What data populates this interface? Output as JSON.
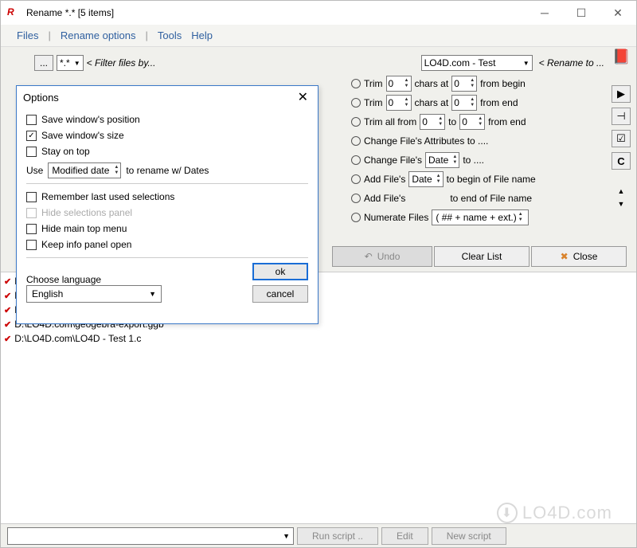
{
  "window": {
    "title": "Rename  *.*    [5 items]"
  },
  "menu": {
    "files": "Files",
    "rename_options": "Rename options",
    "tools": "Tools",
    "help": "Help"
  },
  "toolbar": {
    "browse": "...",
    "filter_value": "*.*",
    "filter_hint": "< Filter files by...",
    "rename_to_value": "LO4D.com - Test",
    "rename_to_hint": "< Rename to ..."
  },
  "radio": {
    "trim_begin_a": "Trim",
    "trim_begin_b": "chars at",
    "trim_begin_c": "from begin",
    "trim_end_c": "from  end",
    "trim_all_a": "Trim all from",
    "trim_all_b": "to",
    "trim_all_c": "from end",
    "change_attr": "Change File's Attributes to ....",
    "change_date_a": "Change File's",
    "change_date_b": "to ....",
    "add_begin_a": "Add File's",
    "add_begin_b": "to begin of File name",
    "add_end_b": "to end of File name",
    "numerate": "Numerate Files",
    "numerate_fmt": "( ## + name + ext.)",
    "date_label": "Date",
    "zero": "0"
  },
  "actions": {
    "undo": "Undo",
    "clear": "Clear List",
    "close": "Close"
  },
  "files": [
    "D:\\",
    "D:\\",
    "D:\\",
    "D:\\LO4D.com\\geogebra-export.ggb",
    "D:\\LO4D.com\\LO4D - Test 1.c"
  ],
  "bottom": {
    "run": "Run script ..",
    "edit": "Edit",
    "new": "New script"
  },
  "dialog": {
    "title": "Options",
    "save_pos": "Save window's position",
    "save_size": "Save window's size",
    "stay_top": "Stay on top",
    "use": "Use",
    "mod_date": "Modified date",
    "rename_dates": "to rename w/ Dates",
    "remember": "Remember last used selections",
    "hide_sel": "Hide selections panel",
    "hide_menu": "Hide main top menu",
    "keep_info": "Keep info panel open",
    "choose_lang": "Choose language",
    "lang": "English",
    "ok": "ok",
    "cancel": "cancel"
  },
  "side_label": "Options",
  "right_tools": {
    "c": "C"
  },
  "watermark": "LO4D.com"
}
